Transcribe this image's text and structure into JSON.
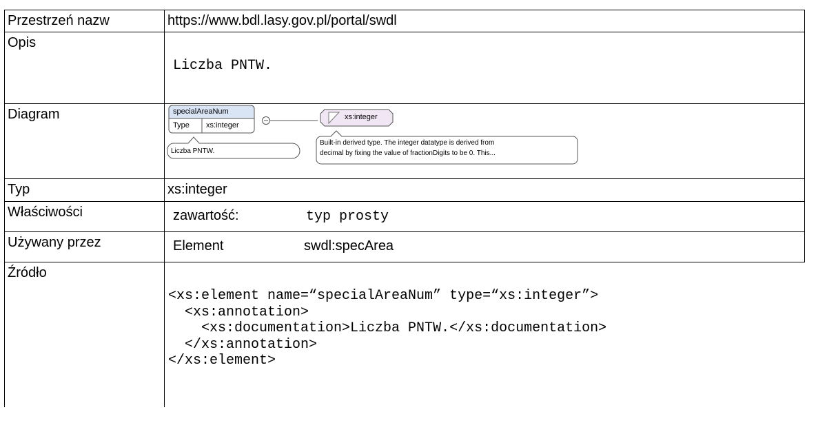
{
  "table": {
    "rows": {
      "namespace": {
        "label": "Przestrzeń nazw",
        "value": "https://www.bdl.lasy.gov.pl/portal/swdl"
      },
      "description": {
        "label": "Opis",
        "value": "Liczba PNTW."
      },
      "diagram": {
        "label": "Diagram",
        "element_name": "specialAreaNum",
        "type_key": "Type",
        "type_value": "xs:integer",
        "annotation": "Liczba PNTW.",
        "type_node_label": "xs:integer",
        "type_doc_line1": "Built-in derived type. The integer datatype is derived from",
        "type_doc_line2": "decimal by fixing the value of fractionDigits to be 0. This..."
      },
      "type": {
        "label": "Typ",
        "value": "xs:integer"
      },
      "properties": {
        "label": "Właściwości",
        "key": "zawartość:",
        "value": "typ prosty"
      },
      "used_by": {
        "label": "Używany przez",
        "kind": "Element",
        "ref": "swdl:specArea"
      },
      "source": {
        "label": "Źródło",
        "code": "<xs:element name=“specialAreaNum” type=“xs:integer”>\n  <xs:annotation>\n    <xs:documentation>Liczba PNTW.</xs:documentation>\n  </xs:annotation>\n</xs:element>"
      }
    }
  },
  "colors": {
    "element_header_fill": "#d9e4f5",
    "type_node_fill": "#f1e6f4",
    "doc_box_fill": "#ffffff",
    "border": "#000000",
    "diagram_stroke": "#555555"
  }
}
